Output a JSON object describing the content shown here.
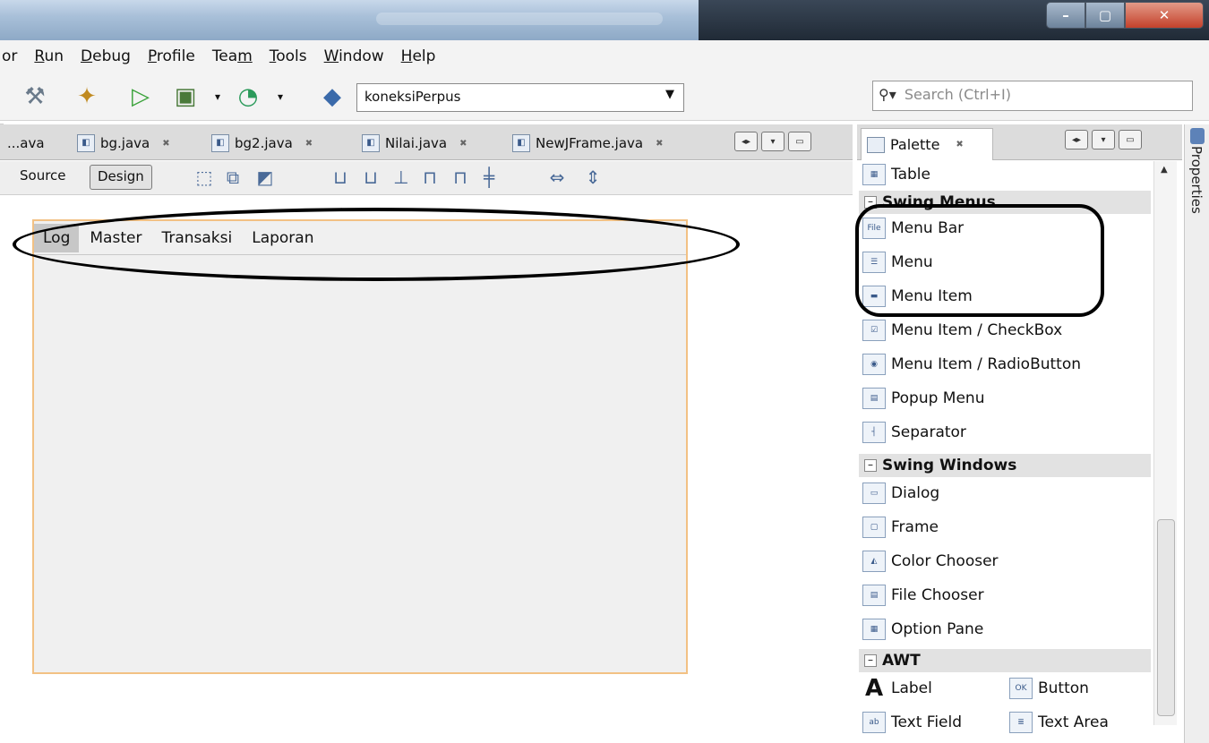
{
  "menubar": {
    "items": [
      {
        "pre": "",
        "u": "",
        "rest": "or"
      },
      {
        "pre": "",
        "u": "R",
        "rest": "un"
      },
      {
        "pre": "",
        "u": "D",
        "rest": "ebug"
      },
      {
        "pre": "",
        "u": "P",
        "rest": "rofile"
      },
      {
        "pre": "Tea",
        "u": "m",
        "rest": ""
      },
      {
        "pre": "",
        "u": "T",
        "rest": "ools"
      },
      {
        "pre": "",
        "u": "W",
        "rest": "indow"
      },
      {
        "pre": "",
        "u": "H",
        "rest": "elp"
      }
    ]
  },
  "toolbar": {
    "config_value": "koneksiPerpus",
    "search_placeholder": "Search (Ctrl+I)"
  },
  "editor_tabs": [
    {
      "label": "...ava",
      "icon": "none"
    },
    {
      "label": "bg.java",
      "icon": "java-form-icon"
    },
    {
      "label": "bg2.java",
      "icon": "java-form-icon"
    },
    {
      "label": "Nilai.java",
      "icon": "java-form-icon"
    },
    {
      "label": "NewJFrame.java",
      "icon": "java-form-icon"
    }
  ],
  "view_toggle": {
    "source": "Source",
    "design": "Design"
  },
  "form_menus": [
    "Log",
    "Master",
    "Transaksi",
    "Laporan"
  ],
  "palette": {
    "tab_label": "Palette",
    "items_top": [
      "Table"
    ],
    "categories": {
      "swing_menus": "Swing Menus",
      "swing_windows": "Swing Windows",
      "awt": "AWT"
    },
    "swing_menus": [
      "Menu Bar",
      "Menu",
      "Menu Item",
      "Menu Item / CheckBox",
      "Menu Item / RadioButton",
      "Popup Menu",
      "Separator"
    ],
    "swing_windows": [
      "Dialog",
      "Frame",
      "Color Chooser",
      "File Chooser",
      "Option Pane"
    ],
    "awt": [
      "Label",
      "Button",
      "Text Field",
      "Text Area"
    ]
  },
  "side_panel": {
    "label": "Properties"
  },
  "colors": {
    "form_border": "#f2c184",
    "selected_menu": "#c7c7c7"
  }
}
